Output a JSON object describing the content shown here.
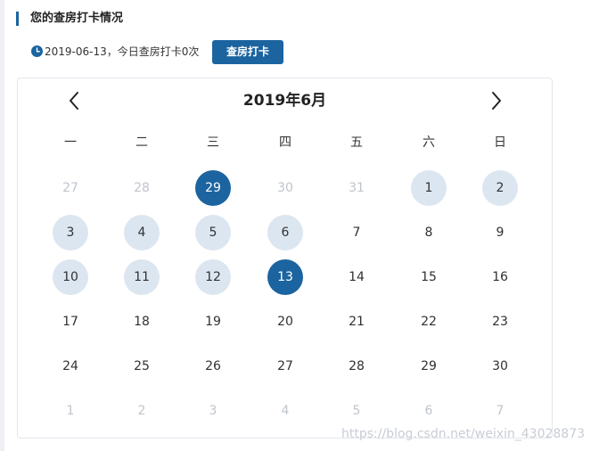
{
  "header": {
    "title": "您的查房打卡情况"
  },
  "status": {
    "text": "2019-06-13，今日查房打卡0次",
    "button_label": "查房打卡"
  },
  "calendar": {
    "month_label": "2019年6月",
    "weekdays": [
      "一",
      "二",
      "三",
      "四",
      "五",
      "六",
      "日"
    ],
    "weeks": [
      [
        {
          "d": "27",
          "state": "other"
        },
        {
          "d": "28",
          "state": "other"
        },
        {
          "d": "29",
          "state": "active"
        },
        {
          "d": "30",
          "state": "other"
        },
        {
          "d": "31",
          "state": "other"
        },
        {
          "d": "1",
          "state": "checked"
        },
        {
          "d": "2",
          "state": "checked"
        }
      ],
      [
        {
          "d": "3",
          "state": "checked"
        },
        {
          "d": "4",
          "state": "checked"
        },
        {
          "d": "5",
          "state": "checked"
        },
        {
          "d": "6",
          "state": "checked"
        },
        {
          "d": "7",
          "state": "normal"
        },
        {
          "d": "8",
          "state": "normal"
        },
        {
          "d": "9",
          "state": "normal"
        }
      ],
      [
        {
          "d": "10",
          "state": "checked"
        },
        {
          "d": "11",
          "state": "checked"
        },
        {
          "d": "12",
          "state": "checked"
        },
        {
          "d": "13",
          "state": "active"
        },
        {
          "d": "14",
          "state": "normal"
        },
        {
          "d": "15",
          "state": "normal"
        },
        {
          "d": "16",
          "state": "normal"
        }
      ],
      [
        {
          "d": "17",
          "state": "normal"
        },
        {
          "d": "18",
          "state": "normal"
        },
        {
          "d": "19",
          "state": "normal"
        },
        {
          "d": "20",
          "state": "normal"
        },
        {
          "d": "21",
          "state": "normal"
        },
        {
          "d": "22",
          "state": "normal"
        },
        {
          "d": "23",
          "state": "normal"
        }
      ],
      [
        {
          "d": "24",
          "state": "normal"
        },
        {
          "d": "25",
          "state": "normal"
        },
        {
          "d": "26",
          "state": "normal"
        },
        {
          "d": "27",
          "state": "normal"
        },
        {
          "d": "28",
          "state": "normal"
        },
        {
          "d": "29",
          "state": "normal"
        },
        {
          "d": "30",
          "state": "normal"
        }
      ],
      [
        {
          "d": "1",
          "state": "other"
        },
        {
          "d": "2",
          "state": "other"
        },
        {
          "d": "3",
          "state": "other"
        },
        {
          "d": "4",
          "state": "other"
        },
        {
          "d": "5",
          "state": "other"
        },
        {
          "d": "6",
          "state": "other"
        },
        {
          "d": "7",
          "state": "other"
        }
      ]
    ]
  },
  "watermark": "https://blog.csdn.net/weixin_43028873",
  "colors": {
    "accent": "#1b64a0",
    "checked": "#dce6f0",
    "muted": "#c0c4cc"
  },
  "icons": {
    "status": "clock-icon",
    "prev": "chevron-left-icon",
    "next": "chevron-right-icon"
  }
}
